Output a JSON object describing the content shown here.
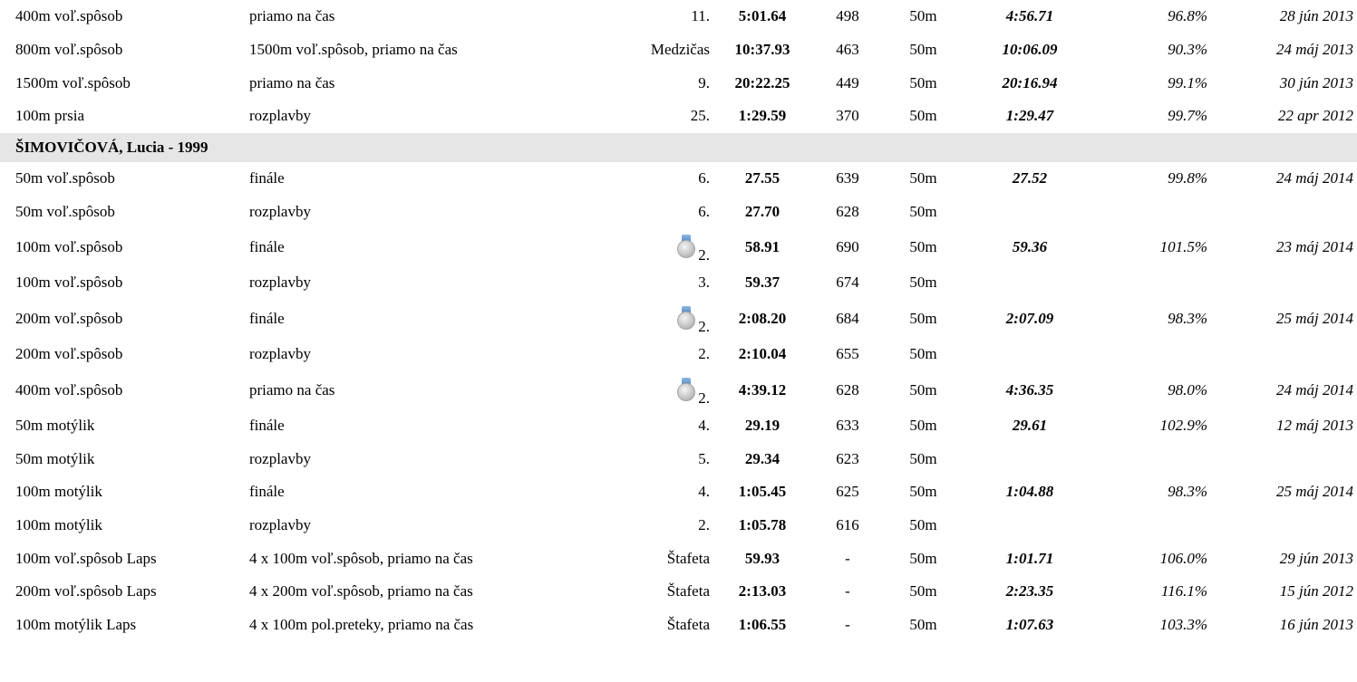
{
  "top_rows": [
    {
      "event": "400m voľ.spôsob",
      "round": "priamo na čas",
      "place": "11.",
      "time": "5:01.64",
      "points": "498",
      "pool": "50m",
      "best": "4:56.71",
      "pct": "96.8%",
      "date": "28 jún 2013"
    },
    {
      "event": "800m voľ.spôsob",
      "round": "1500m voľ.spôsob, priamo na čas",
      "place": "Medzičas",
      "time": "10:37.93",
      "points": "463",
      "pool": "50m",
      "best": "10:06.09",
      "pct": "90.3%",
      "date": "24 máj 2013"
    },
    {
      "event": "1500m voľ.spôsob",
      "round": "priamo na čas",
      "place": "9.",
      "time": "20:22.25",
      "points": "449",
      "pool": "50m",
      "best": "20:16.94",
      "pct": "99.1%",
      "date": "30 jún 2013"
    },
    {
      "event": "100m prsia",
      "round": "rozplavby",
      "place": "25.",
      "time": "1:29.59",
      "points": "370",
      "pool": "50m",
      "best": "1:29.47",
      "pct": "99.7%",
      "date": "22 apr 2012"
    }
  ],
  "swimmer": {
    "name": "ŠIMOVIČOVÁ, Lucia - 1999"
  },
  "rows": [
    {
      "event": "50m voľ.spôsob",
      "round": "finále",
      "place": "6.",
      "time": "27.55",
      "points": "639",
      "pool": "50m",
      "best": "27.52",
      "pct": "99.8%",
      "date": "24 máj 2014"
    },
    {
      "event": "50m voľ.spôsob",
      "round": "rozplavby",
      "place": "6.",
      "time": "27.70",
      "points": "628",
      "pool": "50m",
      "best": "",
      "pct": "",
      "date": ""
    },
    {
      "event": "100m voľ.spôsob",
      "round": "finále",
      "place": "2.",
      "time": "58.91",
      "points": "690",
      "pool": "50m",
      "best": "59.36",
      "pct": "101.5%",
      "date": "23 máj 2014",
      "medal": "silver-medal-icon"
    },
    {
      "event": "100m voľ.spôsob",
      "round": "rozplavby",
      "place": "3.",
      "time": "59.37",
      "points": "674",
      "pool": "50m",
      "best": "",
      "pct": "",
      "date": ""
    },
    {
      "event": "200m voľ.spôsob",
      "round": "finále",
      "place": "2.",
      "time": "2:08.20",
      "points": "684",
      "pool": "50m",
      "best": "2:07.09",
      "pct": "98.3%",
      "date": "25 máj 2014",
      "medal": "silver-medal-icon"
    },
    {
      "event": "200m voľ.spôsob",
      "round": "rozplavby",
      "place": "2.",
      "time": "2:10.04",
      "points": "655",
      "pool": "50m",
      "best": "",
      "pct": "",
      "date": ""
    },
    {
      "event": "400m voľ.spôsob",
      "round": "priamo na čas",
      "place": "2.",
      "time": "4:39.12",
      "points": "628",
      "pool": "50m",
      "best": "4:36.35",
      "pct": "98.0%",
      "date": "24 máj 2014",
      "medal": "silver-medal-icon"
    },
    {
      "event": "50m motýlik",
      "round": "finále",
      "place": "4.",
      "time": "29.19",
      "points": "633",
      "pool": "50m",
      "best": "29.61",
      "pct": "102.9%",
      "date": "12 máj 2013"
    },
    {
      "event": "50m motýlik",
      "round": "rozplavby",
      "place": "5.",
      "time": "29.34",
      "points": "623",
      "pool": "50m",
      "best": "",
      "pct": "",
      "date": ""
    },
    {
      "event": "100m motýlik",
      "round": "finále",
      "place": "4.",
      "time": "1:05.45",
      "points": "625",
      "pool": "50m",
      "best": "1:04.88",
      "pct": "98.3%",
      "date": "25 máj 2014"
    },
    {
      "event": "100m motýlik",
      "round": "rozplavby",
      "place": "2.",
      "time": "1:05.78",
      "points": "616",
      "pool": "50m",
      "best": "",
      "pct": "",
      "date": ""
    },
    {
      "event": "100m voľ.spôsob Laps",
      "round": "4 x 100m voľ.spôsob, priamo na čas",
      "place": "Štafeta",
      "time": "59.93",
      "points": "-",
      "pool": "50m",
      "best": "1:01.71",
      "pct": "106.0%",
      "date": "29 jún 2013"
    },
    {
      "event": "200m voľ.spôsob Laps",
      "round": "4 x 200m voľ.spôsob, priamo na čas",
      "place": "Štafeta",
      "time": "2:13.03",
      "points": "-",
      "pool": "50m",
      "best": "2:23.35",
      "pct": "116.1%",
      "date": "15 jún 2012"
    },
    {
      "event": "100m motýlik Laps",
      "round": "4 x 100m pol.preteky, priamo na čas",
      "place": "Štafeta",
      "time": "1:06.55",
      "points": "-",
      "pool": "50m",
      "best": "1:07.63",
      "pct": "103.3%",
      "date": "16 jún 2013"
    }
  ]
}
